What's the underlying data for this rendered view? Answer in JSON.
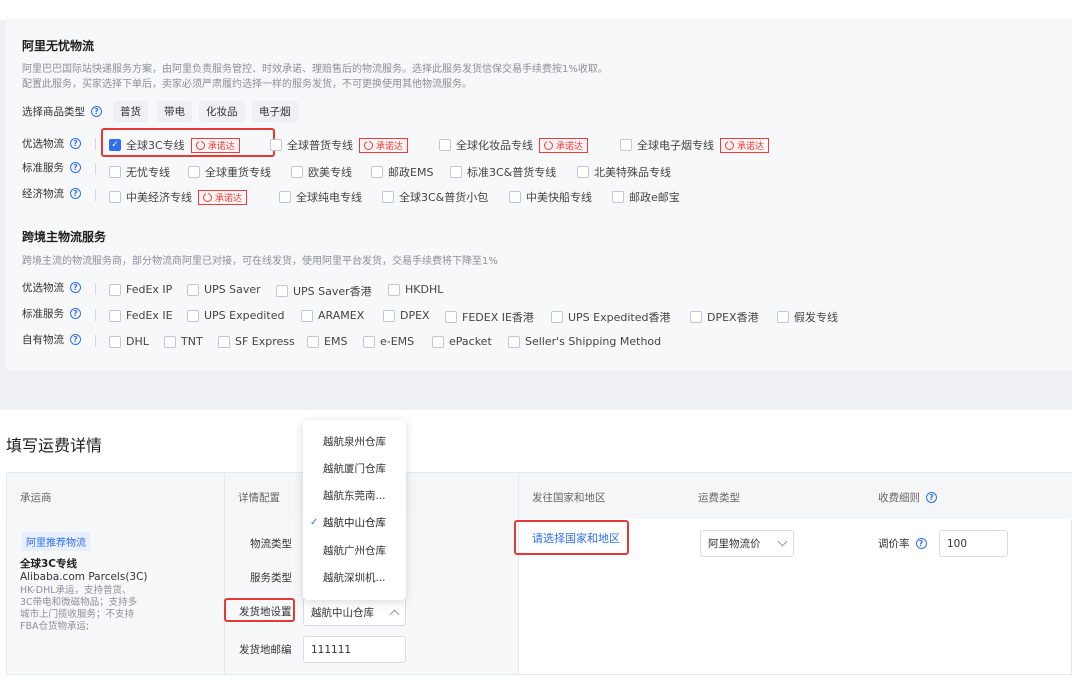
{
  "section_ali": {
    "title": "阿里无忧物流",
    "desc_line1": "阿里巴巴国际站快递服务方案，由阿里负责服务管控、时效承诺、理赔售后的物流服务。选择此服务发货信保交易手续费按1%收取。",
    "desc_line2": "配置此服务，买家选择下单后，卖家必须严肃履约选择一样的服务发货，不可更换使用其他物流服务。",
    "product_type_label": "选择商品类型",
    "product_types": [
      "普货",
      "带电",
      "化妆品",
      "电子烟"
    ],
    "badge_label": "承诺达",
    "preferred_label": "优选物流",
    "preferred": [
      "全球3C专线",
      "全球普货专线",
      "全球化妆品专线",
      "全球电子烟专线"
    ],
    "standard_label": "标准服务",
    "standard": [
      "无忧专线",
      "全球重货专线",
      "欧美专线",
      "邮政EMS",
      "标准3C&普货专线",
      "北美特殊品专线"
    ],
    "economy_label": "经济物流",
    "economy": [
      "中美经济专线",
      "全球纯电专线",
      "全球3C&普货小包",
      "中美快船专线",
      "邮政e邮宝"
    ]
  },
  "section_cross": {
    "title": "跨境主物流服务",
    "desc": "跨境主流的物流服务商，部分物流商阿里已对接，可在线发货，使用阿里平台发货，交易手续费将下降至1%",
    "preferred_label": "优选物流",
    "preferred": [
      "FedEx IP",
      "UPS Saver",
      "UPS Saver香港",
      "HKDHL"
    ],
    "standard_label": "标准服务",
    "standard": [
      "FedEx IE",
      "UPS Expedited",
      "ARAMEX",
      "DPEX",
      "FEDEX IE香港",
      "UPS Expedited香港",
      "DPEX香港",
      "假发专线"
    ],
    "own_label": "自有物流",
    "own": [
      "DHL",
      "TNT",
      "SF Express",
      "EMS",
      "e-EMS",
      "ePacket",
      "Seller's Shipping Method"
    ]
  },
  "freight": {
    "title": "填写运费详情",
    "headers": [
      "承运商",
      "详情配置",
      "发往国家和地区",
      "运费类型",
      "收费细则"
    ],
    "carrier_tag": "阿里推荐物流",
    "carrier_name": "全球3C专线",
    "carrier_sub": "Alibaba.com Parcels(3C)",
    "carrier_desc": "HK-DHL承运，支持普货、3C带电和微磁物品；支持多城市上门揽收服务；不支持FBA仓货物承运;",
    "field_logistics_type": "物流类型",
    "field_service_type": "服务类型",
    "field_origin": "发货地设置",
    "origin_value": "越航中山仓库",
    "field_zip": "发货地邮编",
    "zip_value": "111111",
    "country_link": "请选择国家和地区",
    "freight_type_value": "阿里物流价",
    "rate_label": "调价率",
    "rate_value": "100"
  },
  "dropdown": {
    "options": [
      "越航泉州仓库",
      "越航厦门仓库",
      "越航东莞南...",
      "越航中山仓库",
      "越航广州仓库",
      "越航深圳机..."
    ],
    "selected_index": 3,
    "check_glyph": "✓"
  }
}
